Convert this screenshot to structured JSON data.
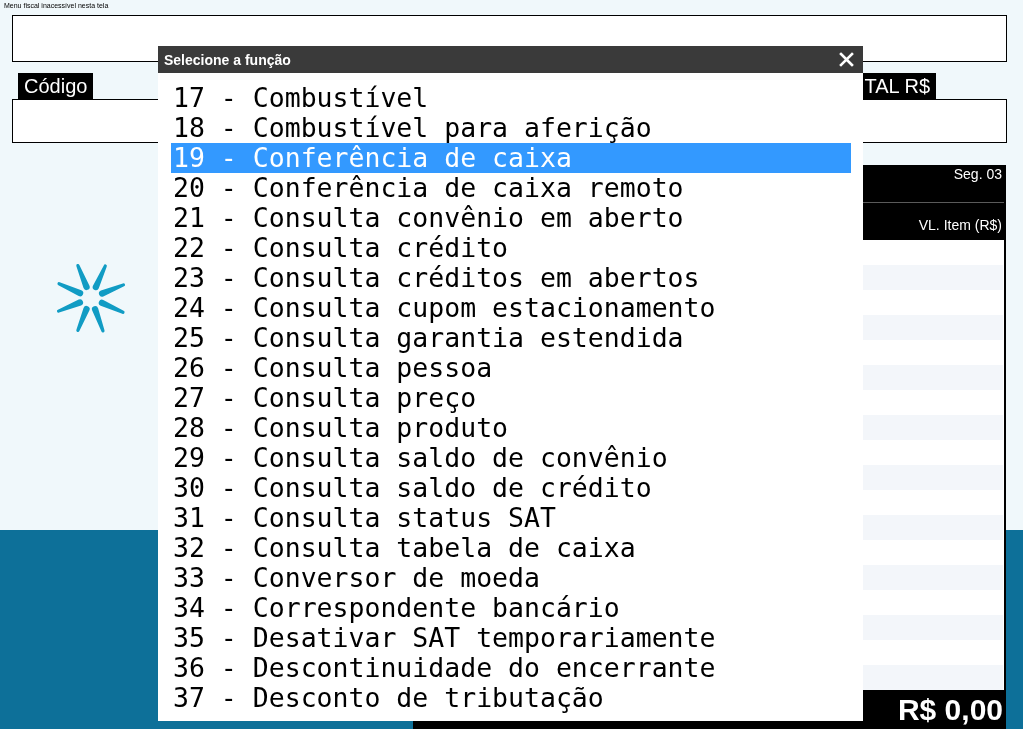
{
  "top_notice": "Menu fiscal inacessível nesta tela",
  "code_field": {
    "label": "Código"
  },
  "total_field": {
    "label": "TAL R$"
  },
  "items_panel": {
    "segment": "Seg. 03",
    "columns": [
      "VL. Item (R$)"
    ],
    "total": "R$ 0,00"
  },
  "dialog": {
    "title": "Selecione a função",
    "options": [
      {
        "label": "17 - Combustível",
        "selected": false
      },
      {
        "label": "18 - Combustível para aferição",
        "selected": false
      },
      {
        "label": "19 - Conferência de caixa",
        "selected": true
      },
      {
        "label": "20 - Conferência de caixa remoto",
        "selected": false
      },
      {
        "label": "21 - Consulta convênio em aberto",
        "selected": false
      },
      {
        "label": "22 - Consulta crédito",
        "selected": false
      },
      {
        "label": "23 - Consulta créditos em abertos",
        "selected": false
      },
      {
        "label": "24 - Consulta cupom estacionamento",
        "selected": false
      },
      {
        "label": "25 - Consulta garantia estendida",
        "selected": false
      },
      {
        "label": "26 - Consulta pessoa",
        "selected": false
      },
      {
        "label": "27 - Consulta preço",
        "selected": false
      },
      {
        "label": "28 - Consulta produto",
        "selected": false
      },
      {
        "label": "29 - Consulta saldo de convênio",
        "selected": false
      },
      {
        "label": "30 - Consulta saldo de crédito",
        "selected": false
      },
      {
        "label": "31 - Consulta status SAT",
        "selected": false
      },
      {
        "label": "32 - Consulta tabela de caixa",
        "selected": false
      },
      {
        "label": "33 - Conversor de moeda",
        "selected": false
      },
      {
        "label": "34 - Correspondente bancário",
        "selected": false
      },
      {
        "label": "35 - Desativar SAT temporariamente",
        "selected": false
      },
      {
        "label": "36 - Descontinuidade do encerrante",
        "selected": false
      },
      {
        "label": "37 - Desconto de tributação",
        "selected": false
      }
    ]
  }
}
